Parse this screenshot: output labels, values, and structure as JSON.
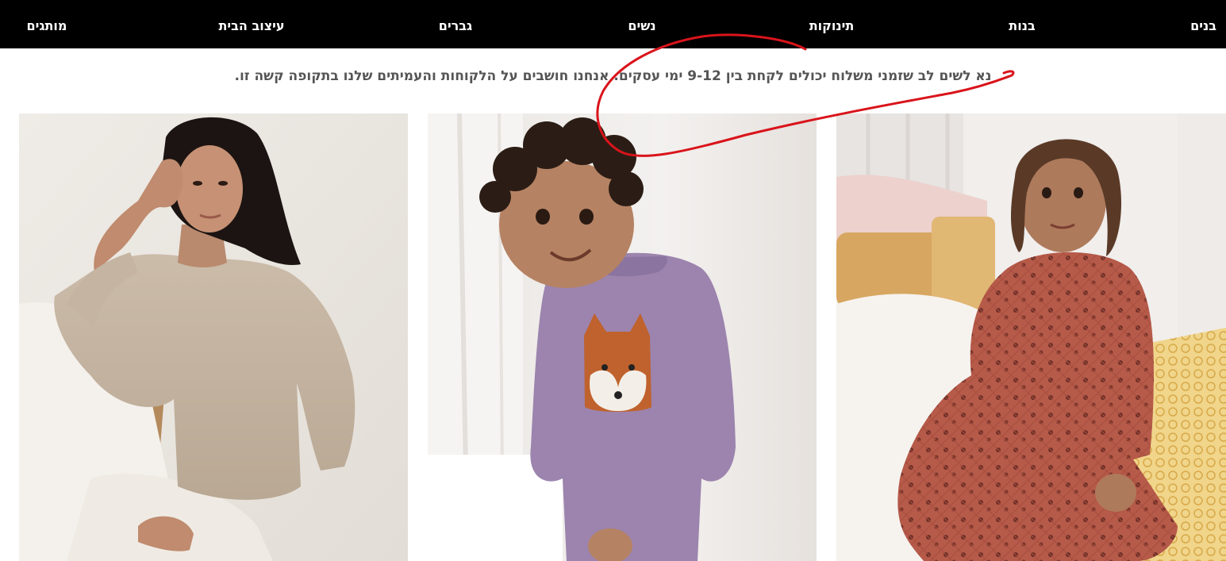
{
  "nav": {
    "items": [
      {
        "id": "boys",
        "label": "בנים"
      },
      {
        "id": "girls",
        "label": "בנות"
      },
      {
        "id": "babies",
        "label": "תינוקות"
      },
      {
        "id": "women",
        "label": "נשים"
      },
      {
        "id": "men",
        "label": "גברים"
      },
      {
        "id": "home",
        "label": "עיצוב הבית"
      },
      {
        "id": "brands",
        "label": "מותגים"
      }
    ]
  },
  "notice": {
    "text": "נא לשים לב שזמני משלוח יכולים לקחת בין 9-12 ימי עסקים. אנחנו חושבים על הלקוחות והעמיתים שלנו בתקופה קשה זו."
  },
  "tiles": [
    {
      "id": "women-tile",
      "subject": "woman-in-knit-sweater"
    },
    {
      "id": "baby-tile",
      "subject": "toddler-in-purple-fox-shirt"
    },
    {
      "id": "girl-tile",
      "subject": "toddler-in-floral-dress"
    }
  ],
  "colors": {
    "nav_background": "#000000",
    "nav_text": "#ffffff",
    "notice_text": "#555555",
    "annotation": "#d9141b"
  }
}
